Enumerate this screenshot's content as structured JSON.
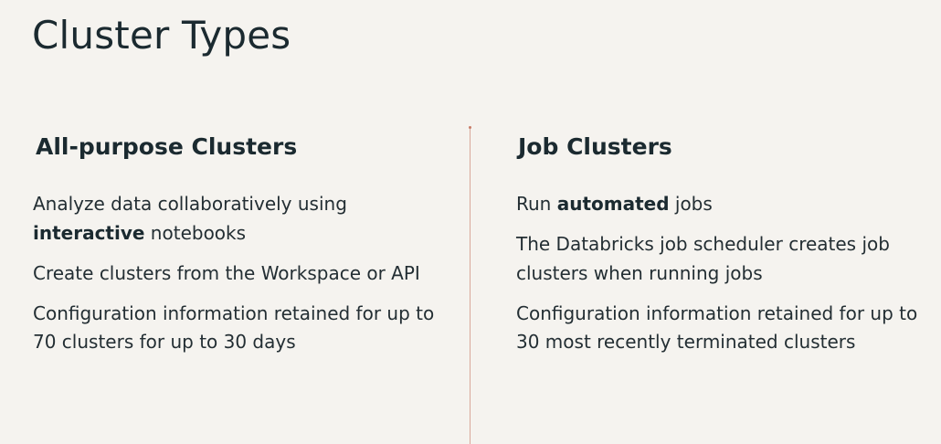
{
  "title": "Cluster Types",
  "columns": [
    {
      "heading": "All-purpose Clusters",
      "items": [
        {
          "before": "Analyze data collaboratively using ",
          "bold": "interactive",
          "after": " notebooks"
        },
        {
          "before": "Create clusters from the Workspace or API",
          "bold": "",
          "after": ""
        },
        {
          "before": "Configuration information retained for up to 70 clusters for up to 30 days",
          "bold": "",
          "after": ""
        }
      ]
    },
    {
      "heading": "Job Clusters",
      "items": [
        {
          "before": "Run ",
          "bold": "automated",
          "after": " jobs"
        },
        {
          "before": "The Databricks job scheduler creates job clusters when running jobs",
          "bold": "",
          "after": ""
        },
        {
          "before": "Configuration information retained for up to 30 most recently terminated clusters",
          "bold": "",
          "after": ""
        }
      ]
    }
  ],
  "colors": {
    "background": "#f5f3ef",
    "text": "#1b2a30",
    "divider": "#d9a89a"
  }
}
